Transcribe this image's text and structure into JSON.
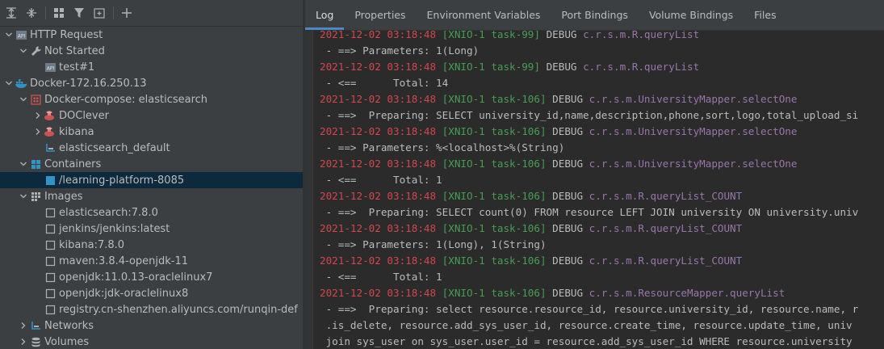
{
  "left_panel": {
    "toolbar_icons": [
      "expand-all-icon",
      "collapse-all-icon",
      "group-icon",
      "filter-icon",
      "new-tab-icon",
      "add-icon"
    ],
    "tree": [
      {
        "id": "http-request",
        "label": "HTTP Request",
        "indent": 0,
        "arrow": "down",
        "icon": "api-icon"
      },
      {
        "id": "not-started",
        "label": "Not Started",
        "indent": 1,
        "arrow": "down",
        "icon": "wrench-icon"
      },
      {
        "id": "test-1",
        "label": "test#1",
        "indent": 2,
        "arrow": "none",
        "icon": "api-icon"
      },
      {
        "id": "docker-host",
        "label": "Docker-172.16.250.13",
        "indent": 0,
        "arrow": "down",
        "icon": "docker-icon"
      },
      {
        "id": "docker-compose",
        "label": "Docker-compose: elasticsearch",
        "indent": 1,
        "arrow": "down",
        "icon": "compose-icon"
      },
      {
        "id": "doclever",
        "label": "DOClever",
        "indent": 2,
        "arrow": "right",
        "icon": "service-icon"
      },
      {
        "id": "kibana-service",
        "label": "kibana",
        "indent": 2,
        "arrow": "right",
        "icon": "service-icon"
      },
      {
        "id": "elasticsearch-default",
        "label": "elasticsearch_default",
        "indent": 2,
        "arrow": "none",
        "icon": "network-icon"
      },
      {
        "id": "containers",
        "label": "Containers",
        "indent": 1,
        "arrow": "down",
        "icon": "containers-icon"
      },
      {
        "id": "learning-platform",
        "label": "/learning-platform-8085",
        "indent": 2,
        "arrow": "none",
        "icon": "container-running-icon",
        "selected": true
      },
      {
        "id": "images",
        "label": "Images",
        "indent": 1,
        "arrow": "down",
        "icon": "images-icon"
      },
      {
        "id": "img-elasticsearch",
        "label": "elasticsearch:7.8.0",
        "indent": 2,
        "arrow": "none",
        "icon": "image-icon"
      },
      {
        "id": "img-jenkins",
        "label": "jenkins/jenkins:latest",
        "indent": 2,
        "arrow": "none",
        "icon": "image-icon"
      },
      {
        "id": "img-kibana",
        "label": "kibana:7.8.0",
        "indent": 2,
        "arrow": "none",
        "icon": "image-icon"
      },
      {
        "id": "img-maven",
        "label": "maven:3.8.4-openjdk-11",
        "indent": 2,
        "arrow": "none",
        "icon": "image-icon"
      },
      {
        "id": "img-openjdk11",
        "label": "openjdk:11.0.13-oraclelinux7",
        "indent": 2,
        "arrow": "none",
        "icon": "image-icon"
      },
      {
        "id": "img-openjdk-jdk",
        "label": "openjdk:jdk-oraclelinux8",
        "indent": 2,
        "arrow": "none",
        "icon": "image-icon"
      },
      {
        "id": "img-registry",
        "label": "registry.cn-shenzhen.aliyuncs.com/runqin-def",
        "indent": 2,
        "arrow": "none",
        "icon": "image-icon"
      },
      {
        "id": "networks",
        "label": "Networks",
        "indent": 1,
        "arrow": "right",
        "icon": "network-icon"
      },
      {
        "id": "volumes",
        "label": "Volumes",
        "indent": 1,
        "arrow": "right",
        "icon": "volumes-icon"
      }
    ]
  },
  "tabs": [
    {
      "id": "log",
      "label": "Log",
      "active": true
    },
    {
      "id": "properties",
      "label": "Properties"
    },
    {
      "id": "env",
      "label": "Environment Variables"
    },
    {
      "id": "ports",
      "label": "Port Bindings"
    },
    {
      "id": "volumes",
      "label": "Volume Bindings"
    },
    {
      "id": "files",
      "label": "Files"
    }
  ],
  "log_lines": [
    {
      "type": "entry",
      "ts": "2021-12-02 03:18:48",
      "thread": "[XNIO-1 task-99]",
      "level": "DEBUG",
      "cls": "c.r.s.m.R.queryList"
    },
    {
      "type": "text",
      "text": " - ==> Parameters: 1(Long)"
    },
    {
      "type": "entry",
      "ts": "2021-12-02 03:18:48",
      "thread": "[XNIO-1 task-99]",
      "level": "DEBUG",
      "cls": "c.r.s.m.R.queryList"
    },
    {
      "type": "text",
      "text": " - <==      Total: 14"
    },
    {
      "type": "entry",
      "ts": "2021-12-02 03:18:48",
      "thread": "[XNIO-1 task-106]",
      "level": "DEBUG",
      "cls": "c.r.s.m.UniversityMapper.selectOne"
    },
    {
      "type": "text",
      "text": " - ==>  Preparing: SELECT university_id,name,description,phone,sort,logo,total_upload_si"
    },
    {
      "type": "entry",
      "ts": "2021-12-02 03:18:48",
      "thread": "[XNIO-1 task-106]",
      "level": "DEBUG",
      "cls": "c.r.s.m.UniversityMapper.selectOne"
    },
    {
      "type": "text",
      "text": " - ==> Parameters: %<localhost>%(String)"
    },
    {
      "type": "entry",
      "ts": "2021-12-02 03:18:48",
      "thread": "[XNIO-1 task-106]",
      "level": "DEBUG",
      "cls": "c.r.s.m.UniversityMapper.selectOne"
    },
    {
      "type": "text",
      "text": " - <==      Total: 1"
    },
    {
      "type": "entry",
      "ts": "2021-12-02 03:18:48",
      "thread": "[XNIO-1 task-106]",
      "level": "DEBUG",
      "cls": "c.r.s.m.R.queryList_COUNT"
    },
    {
      "type": "text",
      "text": " - ==>  Preparing: SELECT count(0) FROM resource LEFT JOIN university ON university.univ"
    },
    {
      "type": "entry",
      "ts": "2021-12-02 03:18:48",
      "thread": "[XNIO-1 task-106]",
      "level": "DEBUG",
      "cls": "c.r.s.m.R.queryList_COUNT"
    },
    {
      "type": "text",
      "text": " - ==> Parameters: 1(Long), 1(String)"
    },
    {
      "type": "entry",
      "ts": "2021-12-02 03:18:48",
      "thread": "[XNIO-1 task-106]",
      "level": "DEBUG",
      "cls": "c.r.s.m.R.queryList_COUNT"
    },
    {
      "type": "text",
      "text": " - <==      Total: 1"
    },
    {
      "type": "entry",
      "ts": "2021-12-02 03:18:48",
      "thread": "[XNIO-1 task-106]",
      "level": "DEBUG",
      "cls": "c.r.s.m.ResourceMapper.queryList"
    },
    {
      "type": "text",
      "text": " - ==>  Preparing: select resource.resource_id, resource.university_id, resource.name, r"
    },
    {
      "type": "text",
      "text": " .is_delete, resource.add_sys_user_id, resource.create_time, resource.update_time, univ"
    },
    {
      "type": "text",
      "text": " join sys_user on sys_user.user_id = resource.add_sys_user_id WHERE resource.university"
    }
  ]
}
